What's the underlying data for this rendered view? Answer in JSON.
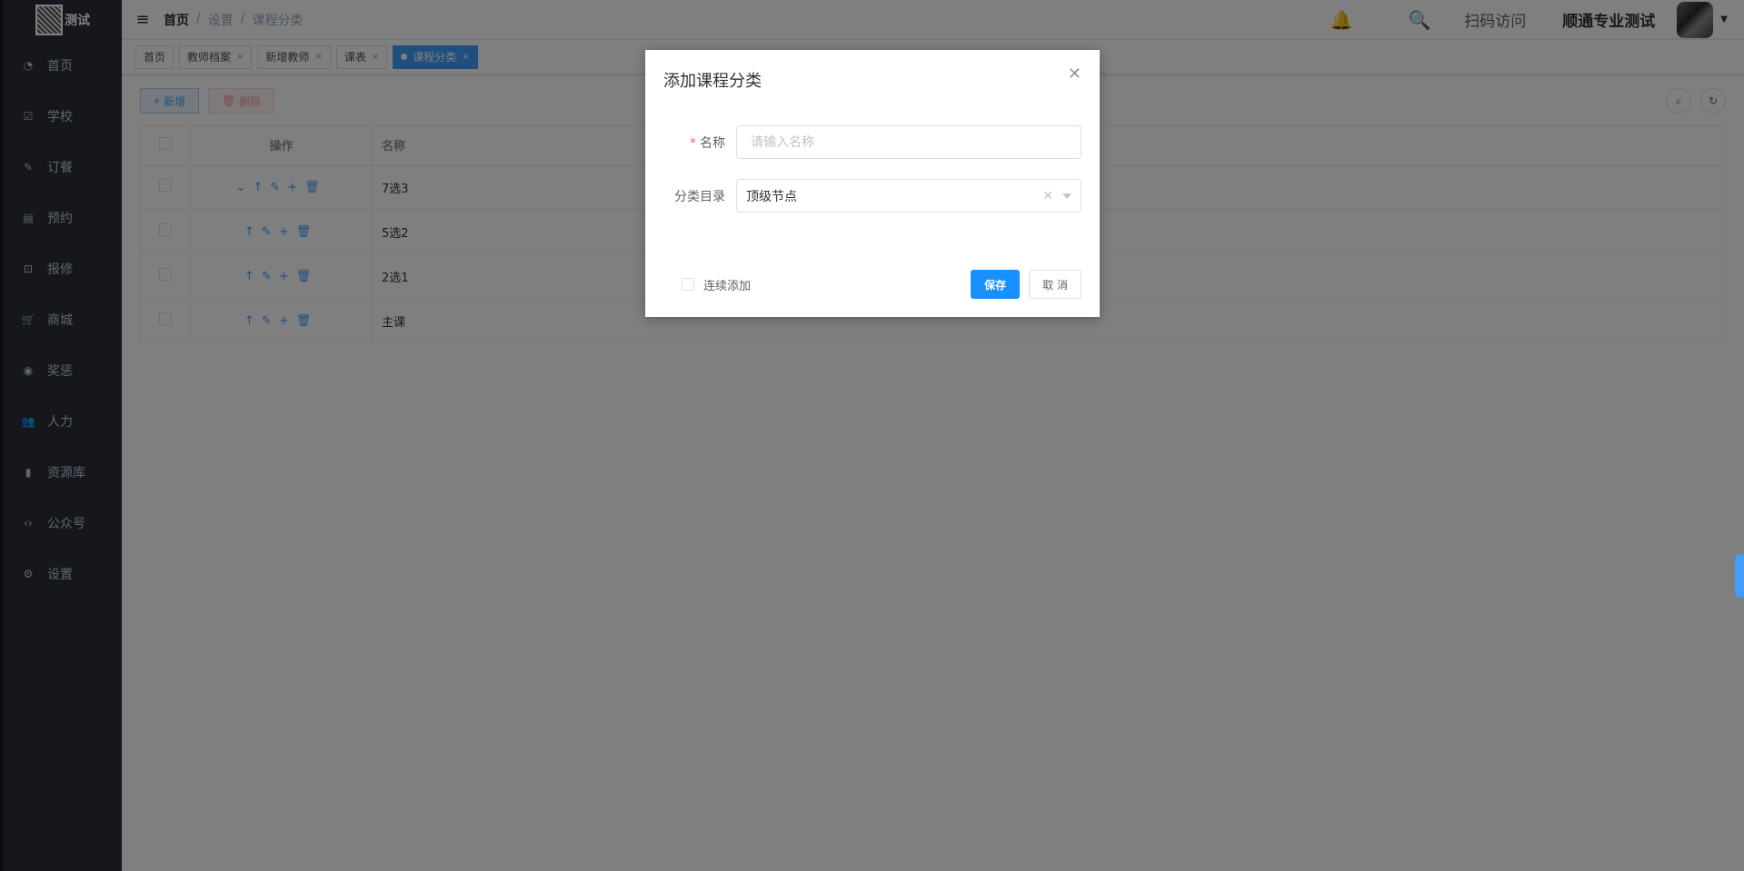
{
  "brand": {
    "text": "测试"
  },
  "sidebar": {
    "items": [
      {
        "label": "首页",
        "icon": "dashboard-icon"
      },
      {
        "label": "学校",
        "icon": "checkbox-icon"
      },
      {
        "label": "订餐",
        "icon": "edit-icon"
      },
      {
        "label": "预约",
        "icon": "calendar-icon"
      },
      {
        "label": "报修",
        "icon": "toolbox-icon"
      },
      {
        "label": "商城",
        "icon": "cart-icon"
      },
      {
        "label": "奖惩",
        "icon": "eye-icon"
      },
      {
        "label": "人力",
        "icon": "people-icon"
      },
      {
        "label": "资源库",
        "icon": "bar-chart-icon"
      },
      {
        "label": "公众号",
        "icon": "code-icon"
      },
      {
        "label": "设置",
        "icon": "settings-icon"
      }
    ]
  },
  "breadcrumb": [
    "首页",
    "设置",
    "课程分类"
  ],
  "breadcrumb_sep": "/",
  "header": {
    "scan_label": "扫码访问",
    "user_name": "顺通专业测试"
  },
  "tags": [
    {
      "label": "首页"
    },
    {
      "label": "教师档案"
    },
    {
      "label": "新增教师"
    },
    {
      "label": "课表"
    },
    {
      "label": "课程分类"
    }
  ],
  "toolbar": {
    "add_label": "新增",
    "delete_label": "删除"
  },
  "table": {
    "columns": [
      "操作",
      "名称"
    ],
    "rows": [
      {
        "name": "7选3"
      },
      {
        "name": "5选2"
      },
      {
        "name": "2选1"
      },
      {
        "name": "主课"
      }
    ]
  },
  "dialog": {
    "title": "添加课程分类",
    "name_label": "名称",
    "name_placeholder": "请输入名称",
    "name_value": "",
    "category_label": "分类目录",
    "category_value": "顶级节点",
    "continuous_label": "连续添加",
    "save_label": "保存",
    "cancel_label": "取 消"
  },
  "colors": {
    "primary": "#409eff",
    "sidebar_bg": "#2b2f3a",
    "danger": "#f56c6c",
    "save": "#1890ff"
  }
}
